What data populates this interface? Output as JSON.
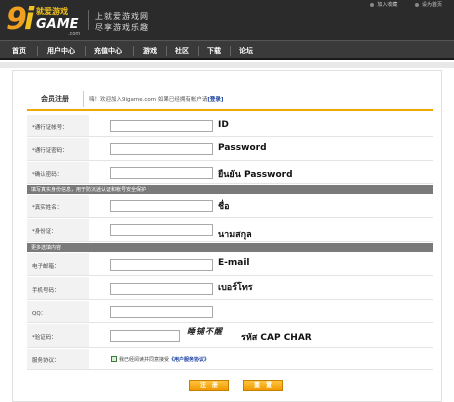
{
  "header": {
    "logo_digit": "9",
    "logo_i": "i",
    "logo_game": "GAME",
    "logo_cn": "就爱游戏",
    "logo_com": ".com",
    "slogan_line1": "上就爱游戏网",
    "slogan_line2": "尽享游戏乐趣",
    "top_link_favorite": "加入收藏",
    "top_link_homepage": "设为首页"
  },
  "nav": {
    "items": [
      "首页",
      "用户中心",
      "充值中心",
      "游戏",
      "社区",
      "下载",
      "论坛"
    ]
  },
  "card": {
    "title": "会员注册",
    "hint_text": "嗨！欢迎加入9igame.com 如果已经拥有帐户请",
    "login_link": "[登录]"
  },
  "form": {
    "account_label": "*通行证帐号：",
    "account_annot": "ID",
    "password_label": "*通行证密码：",
    "password_annot": "Password",
    "confirm_label": "*确认密码：",
    "confirm_annot": "ยืนยัน Password",
    "section1": "填写真实身份信息，用于防沉迷认证和帐号安全保护",
    "realname_label": "*真实姓名：",
    "realname_annot": "ชื่อ",
    "idcard_label": "*身份证：",
    "idcard_annot": "นามสกุล",
    "section2": "更多选填内容",
    "email_label": "电子邮箱：",
    "email_annot": "E-mail",
    "phone_label": "手机号码：",
    "phone_annot": "เบอร์โทร",
    "qq_label": "QQ：",
    "captcha_label": "*验证码：",
    "captcha_image_text": "睡铺不醒",
    "captcha_annot": "รหัส  CAP CHAR",
    "service_label": "服务协议：",
    "agree_text": "我已经阅读并同意接受",
    "agree_link": "《用户服务协议》",
    "submit_label": "注　册",
    "reset_label": "重　置"
  }
}
